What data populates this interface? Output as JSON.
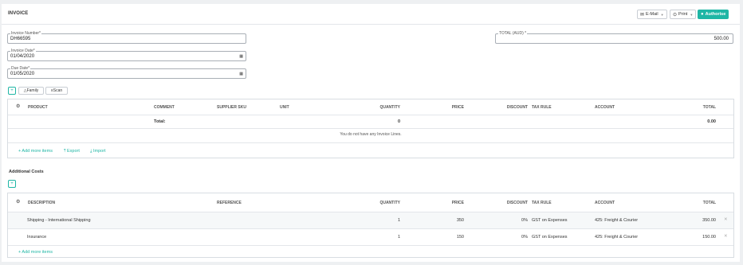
{
  "header": {
    "title": "INVOICE",
    "email_label": "E-Mail",
    "print_label": "Print",
    "authorise_label": "Authorise"
  },
  "form": {
    "invoice_number": {
      "label": "Invoice Number*",
      "value": "DH66595"
    },
    "invoice_date": {
      "label": "Invoice Date*",
      "value": "01/04/2020"
    },
    "due_date": {
      "label": "Due Date*",
      "value": "01/05/2020"
    },
    "total": {
      "label": "TOTAL (AUD) *",
      "value": "500.00"
    }
  },
  "toolbar": {
    "add_label": "+",
    "family_label": "Family",
    "scan_label": "Scan"
  },
  "lines": {
    "columns": {
      "product": "PRODUCT",
      "comment": "COMMENT",
      "supplier_sku": "SUPPLIER SKU",
      "unit": "UNIT",
      "quantity": "QUANTITY",
      "price": "PRICE",
      "discount": "DISCOUNT",
      "tax_rule": "TAX RULE",
      "account": "ACCOUNT",
      "total": "TOTAL"
    },
    "total_row": {
      "label": "Total:",
      "quantity": "0",
      "total": "0.00"
    },
    "empty_message": "You do not have any Invoice Lines.",
    "add_more": "+ Add more items",
    "export": "Export",
    "import": "Import"
  },
  "additional_costs": {
    "title": "Additional Costs",
    "add_label": "+",
    "columns": {
      "description": "DESCRIPTION",
      "reference": "REFERENCE",
      "quantity": "QUANTITY",
      "price": "PRICE",
      "discount": "DISCOUNT",
      "tax_rule": "TAX RULE",
      "account": "ACCOUNT",
      "total": "TOTAL"
    },
    "rows": [
      {
        "description": "Shipping - International Shipping",
        "reference": "",
        "quantity": "1",
        "price": "350",
        "discount": "0%",
        "tax_rule": "GST on Expenses",
        "account": "425: Freight & Courier",
        "total": "350.00"
      },
      {
        "description": "Insurance",
        "reference": "",
        "quantity": "1",
        "price": "150",
        "discount": "0%",
        "tax_rule": "GST on Expenses",
        "account": "425: Freight & Courier",
        "total": "150.00"
      }
    ],
    "add_more": "+ Add more items"
  },
  "icons": {
    "gear": "gear-icon",
    "calendar": "calendar-icon",
    "remove": "close-icon",
    "mail": "mail-icon",
    "printer": "printer-icon",
    "check": "check-circle-icon"
  },
  "colors": {
    "accent": "#1fb6a5"
  }
}
